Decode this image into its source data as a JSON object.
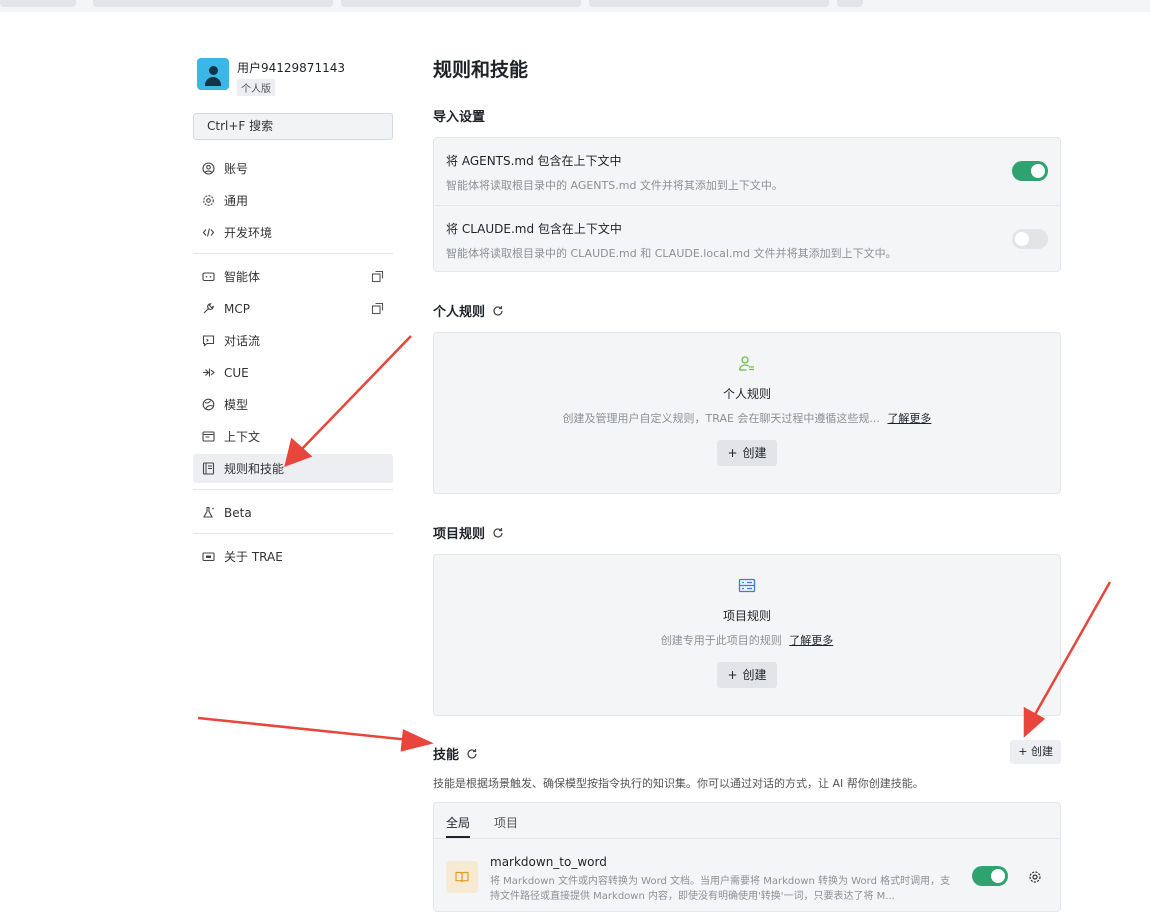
{
  "user": {
    "name": "用户94129871143",
    "plan": "个人版"
  },
  "search": {
    "label": "Ctrl+F 搜索"
  },
  "sidebar": {
    "items": [
      {
        "label": "账号",
        "icon": "user-circle-icon"
      },
      {
        "label": "通用",
        "icon": "gear-icon"
      },
      {
        "label": "开发环境",
        "icon": "code-icon"
      },
      {
        "label": "智能体",
        "icon": "agent-icon"
      },
      {
        "label": "MCP",
        "icon": "wrench-icon"
      },
      {
        "label": "对话流",
        "icon": "chat-flow-icon"
      },
      {
        "label": "CUE",
        "icon": "cue-icon"
      },
      {
        "label": "模型",
        "icon": "model-icon"
      },
      {
        "label": "上下文",
        "icon": "context-icon"
      },
      {
        "label": "规则和技能",
        "icon": "rules-icon"
      },
      {
        "label": "Beta",
        "icon": "flask-icon"
      },
      {
        "label": "关于 TRAE",
        "icon": "about-icon"
      }
    ]
  },
  "page": {
    "title": "规则和技能"
  },
  "import_settings": {
    "title": "导入设置",
    "agents": {
      "title": "将 AGENTS.md 包含在上下文中",
      "desc": "智能体将读取根目录中的 AGENTS.md 文件并将其添加到上下文中。",
      "enabled": true
    },
    "claude": {
      "title": "将 CLAUDE.md 包含在上下文中",
      "desc": "智能体将读取根目录中的 CLAUDE.md 和 CLAUDE.local.md 文件并将其添加到上下文中。",
      "enabled": false
    }
  },
  "personal_rules": {
    "title": "个人规则",
    "empty_title": "个人规则",
    "empty_desc": "创建及管理用户自定义规则，TRAE 会在聊天过程中遵循这些规...",
    "learn_more": "了解更多",
    "create": "创建"
  },
  "project_rules": {
    "title": "项目规则",
    "empty_title": "项目规则",
    "empty_desc": "创建专用于此项目的规则",
    "learn_more": "了解更多",
    "create": "创建"
  },
  "skills": {
    "title": "技能",
    "create": "创建",
    "desc": "技能是根据场景触发、确保模型按指令执行的知识集。你可以通过对话的方式，让 AI 帮你创建技能。",
    "tabs": [
      "全局",
      "项目"
    ],
    "items": [
      {
        "name": "markdown_to_word",
        "desc": "将 Markdown 文件或内容转换为 Word 文档。当用户需要将 Markdown 转换为 Word 格式时调用，支持文件路径或直接提供 Markdown 内容，即使没有明确使用'转换'一词，只要表达了将 M...",
        "enabled": true
      }
    ]
  },
  "colors": {
    "toggle_on": "#2ea36f",
    "arrow": "#e8453c",
    "personal_icon": "#6cc04a",
    "project_icon": "#3c7be0",
    "skill_icon_bg": "#f7ead3"
  }
}
